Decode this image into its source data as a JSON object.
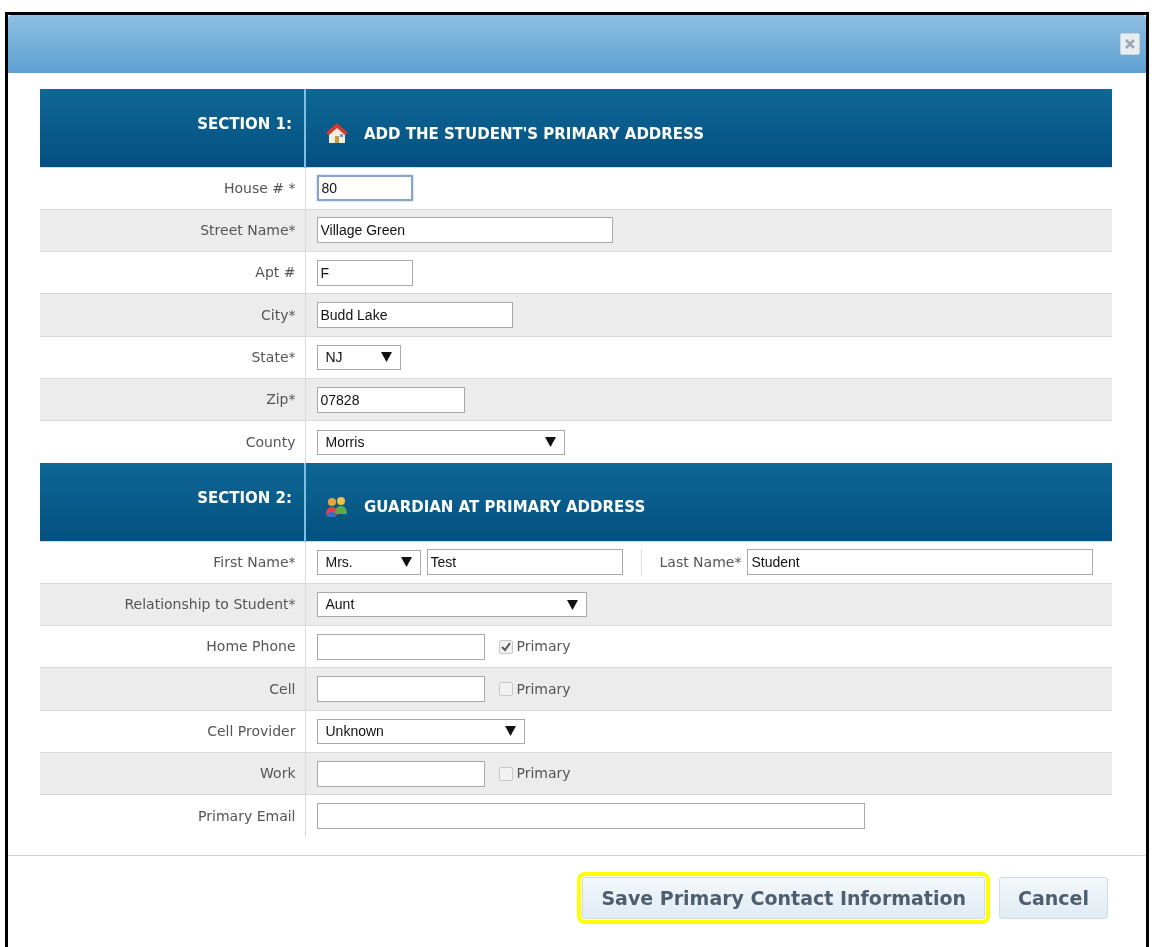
{
  "sections": [
    {
      "label": "SECTION 1:",
      "title": "ADD THE STUDENT'S PRIMARY ADDRESS",
      "rows": [
        {
          "label": "House # *",
          "controls": [
            {
              "kind": "text",
              "value": "80",
              "focused": true
            }
          ]
        },
        {
          "label": "Street Name*",
          "controls": [
            {
              "kind": "text",
              "value": "Village Green"
            }
          ]
        },
        {
          "label": "Apt #",
          "controls": [
            {
              "kind": "text",
              "value": "F"
            }
          ]
        },
        {
          "label": "City*",
          "controls": [
            {
              "kind": "text",
              "value": "Budd Lake"
            }
          ]
        },
        {
          "label": "State*",
          "controls": [
            {
              "kind": "select",
              "value": "NJ"
            }
          ]
        },
        {
          "label": "Zip*",
          "controls": [
            {
              "kind": "text",
              "value": "07828"
            }
          ]
        },
        {
          "label": "County",
          "controls": [
            {
              "kind": "select",
              "value": "Morris"
            }
          ]
        }
      ]
    },
    {
      "label": "SECTION 2:",
      "title": "GUARDIAN AT PRIMARY ADDRESS",
      "rows": [
        {
          "label": "First Name*",
          "controls": [
            {
              "kind": "select",
              "value": "Mrs."
            },
            {
              "kind": "text",
              "value": "Test"
            },
            {
              "kind": "label",
              "text": "Last Name*"
            },
            {
              "kind": "text",
              "value": "Student"
            }
          ]
        },
        {
          "label": "Relationship to Student*",
          "controls": [
            {
              "kind": "select",
              "value": "Aunt"
            }
          ]
        },
        {
          "label": "Home Phone",
          "controls": [
            {
              "kind": "text"
            },
            {
              "kind": "check",
              "text": "Primary",
              "checked": true
            }
          ]
        },
        {
          "label": "Cell",
          "controls": [
            {
              "kind": "text"
            },
            {
              "kind": "check",
              "text": "Primary",
              "checked": false
            }
          ]
        },
        {
          "label": "Cell Provider",
          "controls": [
            {
              "kind": "select",
              "value": "Unknown"
            }
          ]
        },
        {
          "label": "Work",
          "controls": [
            {
              "kind": "text"
            },
            {
              "kind": "check",
              "text": "Primary",
              "checked": false
            }
          ]
        },
        {
          "label": "Primary Email",
          "controls": [
            {
              "kind": "text"
            }
          ]
        }
      ]
    }
  ],
  "buttons": [
    {
      "label": "Save Primary Contact Information",
      "highlighted": true
    },
    {
      "label": "Cancel",
      "highlighted": false
    }
  ]
}
